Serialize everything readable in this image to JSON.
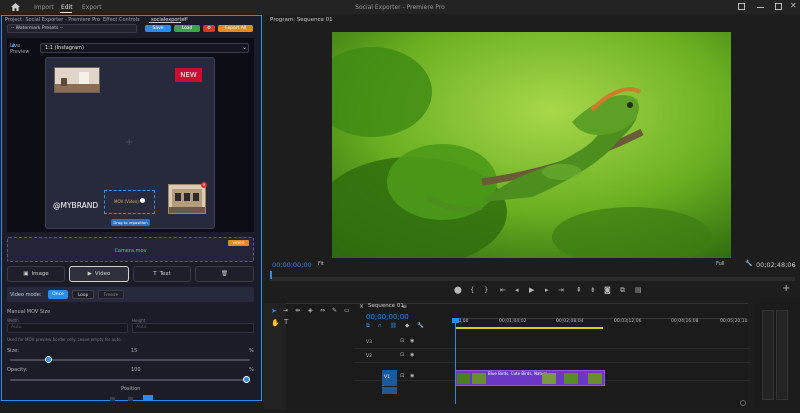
{
  "topbar": {
    "home_icon": "home-icon",
    "nav": [
      "Import",
      "Edit",
      "Export"
    ],
    "title": "Social Exporter - Premiere Pro",
    "right_icons": [
      "export-panel-icon",
      "minimize-icon",
      "maximize-icon",
      "close-icon"
    ]
  },
  "panel_tabs": {
    "project": "Project: Social Exporter - Premiere Pro",
    "effect_controls": "Effect Controls",
    "social": "socialexporter"
  },
  "header": {
    "preset_select": "-- Watermark Presets --",
    "buttons": [
      "Save",
      "Load",
      "⚙",
      "Export All"
    ]
  },
  "preview": {
    "live_label": "Live Preview",
    "ratio_select": "1:1 (Instagram)",
    "new_badge": "NEW",
    "brand_text": "@MYBRAND",
    "mov_badge": "MOV (Video)",
    "snap_tooltip": "Drag to reposition",
    "mov_file": "Camera.mov",
    "mov_tag": "VIDEO"
  },
  "type_buttons": [
    "Image",
    "Video",
    "Text"
  ],
  "video_mode": {
    "label": "Video mode:",
    "options": [
      "Once",
      "Loop",
      "Freeze"
    ],
    "selected": "Loop"
  },
  "manual_size": {
    "title": "Manual MOV Size",
    "width_label": "Width",
    "height_label": "Height",
    "width_placeholder": "Auto",
    "height_placeholder": "Auto",
    "hint": "Used for MOV preview border only. Leave empty for auto."
  },
  "size": {
    "label": "Size:",
    "value": "15",
    "unit": "%",
    "fraction": 0.15
  },
  "opacity": {
    "label": "Opacity:",
    "value": "100",
    "unit": "%",
    "fraction": 1.0
  },
  "position": {
    "label": "Position"
  },
  "program": {
    "label": "Program: Sequence 01",
    "timecode": "00;00;00;00",
    "fit": "Fit",
    "full": "Full",
    "duration": "00;02;48;06"
  },
  "timeline": {
    "sequence": "Sequence 01",
    "timecode": "00;00;00;00",
    "ruler": [
      ":00;00",
      "00;01;04;02",
      "00;02;08;04",
      "00;03;12;06",
      "00;04;16;08",
      "00;05;20;10"
    ],
    "tracks": [
      "V3",
      "V2",
      "V1"
    ],
    "clip_label": "Blue Birds, Cute Birds, Nature..."
  },
  "colors": {
    "accent": "#2d8ceb",
    "new_badge": "#c8102e",
    "clip": "#6b37c4",
    "file_text": "#39e069"
  }
}
